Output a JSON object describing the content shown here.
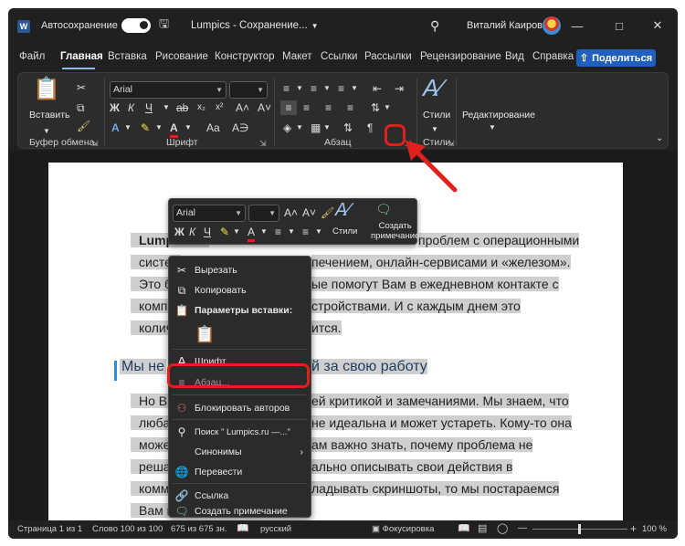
{
  "titlebar": {
    "app_icon": "word-icon",
    "autosave_label": "Автосохранение",
    "doc_title": "Lumpics - Сохранение...",
    "user_name": "Виталий Каиров"
  },
  "menu": {
    "tabs": [
      "Файл",
      "Главная",
      "Вставка",
      "Рисование",
      "Конструктор",
      "Макет",
      "Ссылки",
      "Рассылки",
      "Рецензирование",
      "Вид",
      "Справка"
    ],
    "active": "Главная",
    "share_label": "Поделиться"
  },
  "ribbon": {
    "paste_label": "Вставить",
    "font_name": "Arial",
    "font_size": "",
    "bold": "Ж",
    "italic": "К",
    "underline": "Ч",
    "styles_label": "Стили",
    "editing_label": "Редактирование",
    "groups": {
      "clipboard": "Буфер обмена",
      "font": "Шрифт",
      "paragraph": "Абзац",
      "styles": "Стили"
    }
  },
  "document": {
    "lines": [
      "Lumpics.ru",
      "проблем с операционными",
      "систем",
      "печением, онлайн-сервисами и «железом».",
      "Это бо",
      "ые помогут Вам в ежедневном контакте с",
      "компь",
      "стройствами. И с каждым днем это",
      "количе",
      "ится.",
      "Но Вы",
      "ей критикой и замечаниями. Мы знаем, что",
      "любая",
      "не идеальна и может устареть. Кому-то она",
      "может",
      "ам важно знать, почему проблема не",
      "решае",
      "ально описывать свои действия в",
      "комме",
      "ладывать скриншоты, то мы постараемся",
      "Вам по"
    ],
    "heading_left": "Мы не",
    "heading_right": "й за свою работу"
  },
  "minitoolbar": {
    "font_name": "Arial",
    "bold": "Ж",
    "italic": "К",
    "underline": "Ч",
    "styles_label": "Стили",
    "comment_label_1": "Создать",
    "comment_label_2": "примечание"
  },
  "context_menu": {
    "cut": "Вырезать",
    "copy": "Копировать",
    "paste_options": "Параметры вставки:",
    "font": "Шрифт...",
    "paragraph": "Абзац...",
    "block_authors": "Блокировать авторов",
    "search": "Поиск \" Lumpics.ru —...\"",
    "synonyms": "Синонимы",
    "translate": "Перевести",
    "link": "Ссылка",
    "new_comment": "Создать примечание"
  },
  "statusbar": {
    "page": "Страница 1 из 1",
    "words": "Слово 100 из 100",
    "chars": "675 из 675 зн.",
    "language": "русский",
    "focus": "Фокусировка",
    "zoom": "100 %"
  },
  "colors": {
    "highlight": "#cfcfcf",
    "accent": "#1f5fbf",
    "annotation_red": "#e0201c"
  }
}
